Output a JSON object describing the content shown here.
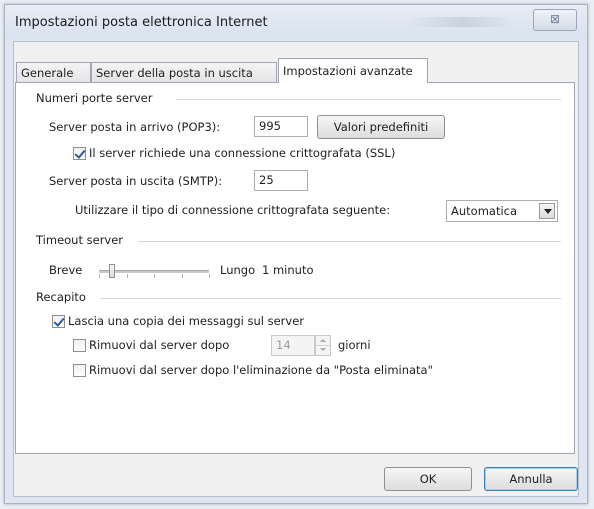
{
  "window": {
    "title": "Impostazioni posta elettronica Internet",
    "close_glyph": "⊠"
  },
  "tabs": [
    {
      "label": "Generale"
    },
    {
      "label": "Server della posta in uscita"
    },
    {
      "label": "Impostazioni avanzate",
      "active": true
    }
  ],
  "ports": {
    "section_title": "Numeri porte server",
    "incoming_label": "Server posta in arrivo (POP3):",
    "incoming_value": "995",
    "defaults_button": "Valori predefiniti",
    "ssl_label": "Il server richiede una connessione crittografata (SSL)",
    "ssl_checked": true,
    "outgoing_label": "Server posta in uscita (SMTP):",
    "outgoing_value": "25",
    "encryption_label": "Utilizzare il tipo di connessione crittografata seguente:",
    "encryption_value": "Automatica"
  },
  "timeout": {
    "section_title": "Timeout server",
    "short_label": "Breve",
    "long_label": "Lungo",
    "value_text": "1 minuto",
    "slider_fraction": 0.12
  },
  "delivery": {
    "section_title": "Recapito",
    "leave_copy_label": "Lascia una copia dei messaggi sul server",
    "leave_copy_checked": true,
    "remove_after_label": "Rimuovi dal server dopo",
    "remove_after_checked": false,
    "remove_after_days": "14",
    "days_label": "giorni",
    "remove_deleted_label": "Rimuovi dal server dopo l'eliminazione da \"Posta eliminata\"",
    "remove_deleted_checked": false
  },
  "buttons": {
    "ok": "OK",
    "cancel": "Annulla"
  }
}
